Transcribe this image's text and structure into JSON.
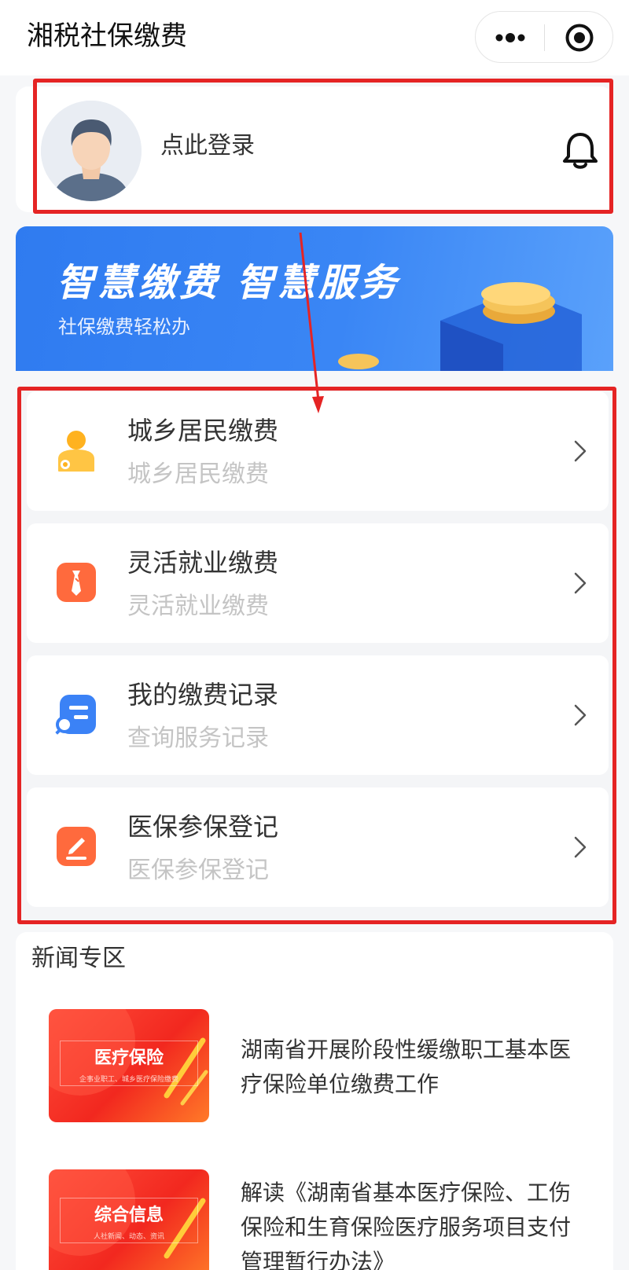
{
  "header": {
    "title": "湘税社保缴费",
    "more_icon": "more-dots-icon",
    "close_icon": "target-circle-icon"
  },
  "profile": {
    "login_text": "点此登录",
    "avatar_icon": "user-avatar-icon",
    "bell_icon": "bell-icon"
  },
  "banner": {
    "title": "智慧缴费  智慧服务",
    "subtitle": "社保缴费轻松办"
  },
  "services": [
    {
      "title": "城乡居民缴费",
      "subtitle": "城乡居民缴费",
      "icon": "resident-person-icon",
      "color": "#ffb21f"
    },
    {
      "title": "灵活就业缴费",
      "subtitle": "灵活就业缴费",
      "icon": "necktie-icon",
      "color": "#ff6a3d"
    },
    {
      "title": "我的缴费记录",
      "subtitle": "查询服务记录",
      "icon": "record-search-icon",
      "color": "#3b82f6"
    },
    {
      "title": "医保参保登记",
      "subtitle": "医保参保登记",
      "icon": "pencil-edit-icon",
      "color": "#ff6a3d"
    }
  ],
  "news": {
    "heading": "新闻专区",
    "items": [
      {
        "thumb_title": "医疗保险",
        "thumb_caption": "企事业职工、城乡医疗保险缴费",
        "title": "湖南省开展阶段性缓缴职工基本医疗保险单位缴费工作"
      },
      {
        "thumb_title": "综合信息",
        "thumb_caption": "人社新闻、动态、资讯",
        "title": "解读《湖南省基本医疗保险、工伤保险和生育保险医疗服务项目支付管理暂行办法》"
      }
    ]
  },
  "colors": {
    "annotation_red": "#e52424",
    "banner_blue": "#3a86f5"
  }
}
